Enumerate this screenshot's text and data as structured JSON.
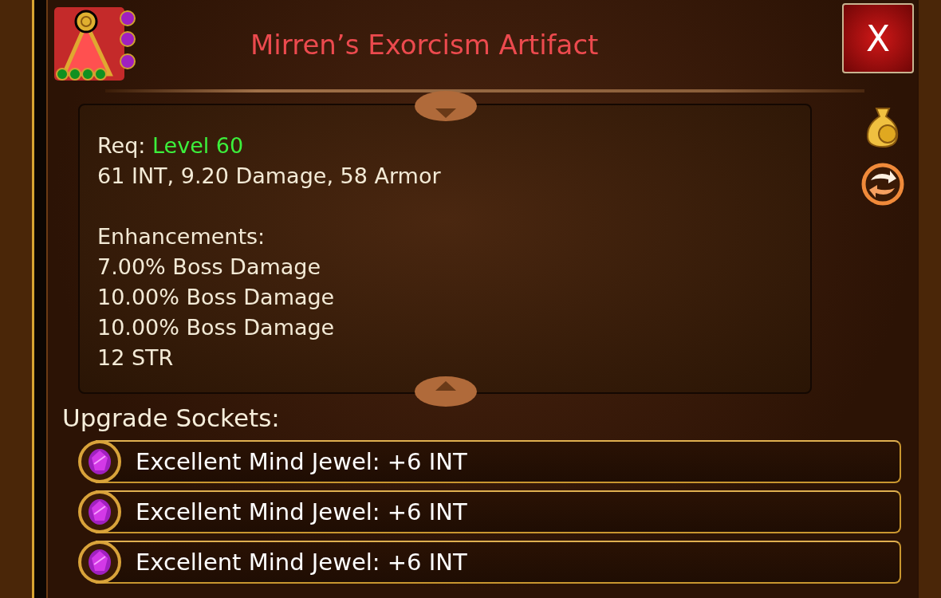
{
  "item": {
    "title": "Mirren’s Exorcism Artifact"
  },
  "close_button": {
    "label": "X"
  },
  "stats": {
    "requirement_label": "Req:",
    "requirement_value": "Level 60",
    "summary": "61 INT, 9.20 Damage, 58 Armor",
    "enhancements_heading": "Enhancements:",
    "enhancements": [
      "7.00% Boss Damage",
      "10.00% Boss Damage",
      "10.00% Boss Damage",
      "12 STR"
    ]
  },
  "sockets": {
    "heading": "Upgrade Sockets:",
    "items": [
      {
        "text": "Excellent Mind Jewel: +6 INT"
      },
      {
        "text": "Excellent Mind Jewel: +6 INT"
      },
      {
        "text": "Excellent Mind Jewel: +6 INT"
      }
    ]
  }
}
